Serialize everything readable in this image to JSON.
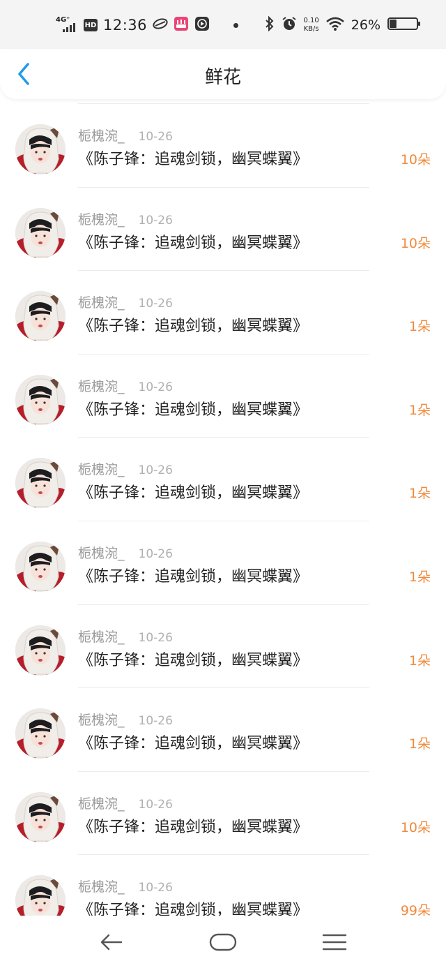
{
  "status_bar": {
    "network": "4G⁺",
    "hd": "HD",
    "time": "12:36",
    "net_speed_value": "0.10",
    "net_speed_unit": "KB/s",
    "battery_percent": "26%",
    "battery_level": 0.26,
    "icons": [
      "signal-icon",
      "hd-icon",
      "app-icon",
      "app-icon",
      "record-icon",
      "bluetooth-icon",
      "alarm-icon",
      "wifi-icon",
      "battery-icon"
    ]
  },
  "header": {
    "title": "鲜花",
    "back_icon": "chevron-left-icon",
    "accent": "#1e9bef"
  },
  "colors": {
    "count": "#f08a3c"
  },
  "items": [
    {
      "user": "栀槐涴_",
      "date": "10-26",
      "book": "《陈子锋：追魂剑锁，幽冥蝶翼》",
      "count": "10朵"
    },
    {
      "user": "栀槐涴_",
      "date": "10-26",
      "book": "《陈子锋：追魂剑锁，幽冥蝶翼》",
      "count": "10朵"
    },
    {
      "user": "栀槐涴_",
      "date": "10-26",
      "book": "《陈子锋：追魂剑锁，幽冥蝶翼》",
      "count": "1朵"
    },
    {
      "user": "栀槐涴_",
      "date": "10-26",
      "book": "《陈子锋：追魂剑锁，幽冥蝶翼》",
      "count": "1朵"
    },
    {
      "user": "栀槐涴_",
      "date": "10-26",
      "book": "《陈子锋：追魂剑锁，幽冥蝶翼》",
      "count": "1朵"
    },
    {
      "user": "栀槐涴_",
      "date": "10-26",
      "book": "《陈子锋：追魂剑锁，幽冥蝶翼》",
      "count": "1朵"
    },
    {
      "user": "栀槐涴_",
      "date": "10-26",
      "book": "《陈子锋：追魂剑锁，幽冥蝶翼》",
      "count": "1朵"
    },
    {
      "user": "栀槐涴_",
      "date": "10-26",
      "book": "《陈子锋：追魂剑锁，幽冥蝶翼》",
      "count": "1朵"
    },
    {
      "user": "栀槐涴_",
      "date": "10-26",
      "book": "《陈子锋：追魂剑锁，幽冥蝶翼》",
      "count": "10朵"
    },
    {
      "user": "栀槐涴_",
      "date": "10-26",
      "book": "《陈子锋：追魂剑锁，幽冥蝶翼》",
      "count": "99朵"
    }
  ],
  "bottom_nav": {
    "icons": [
      "back-arrow-icon",
      "home-icon",
      "menu-icon"
    ]
  }
}
